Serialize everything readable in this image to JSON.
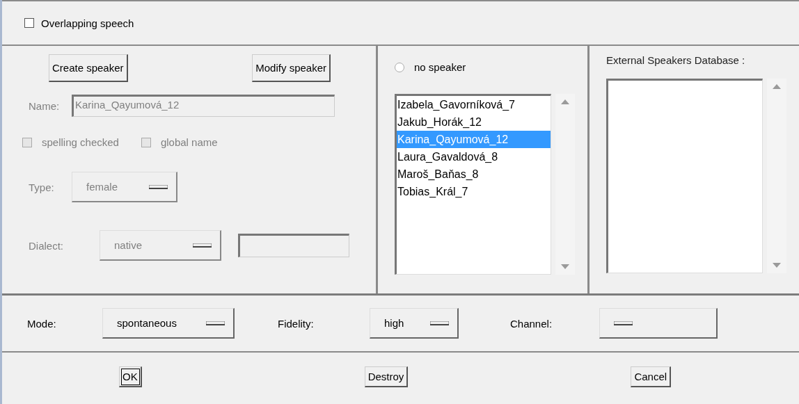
{
  "overlapping_speech": {
    "label": "Overlapping speech",
    "checked": false
  },
  "speaker_form": {
    "create_button": "Create speaker",
    "modify_button": "Modify speaker",
    "name": {
      "label": "Name:",
      "value": "Karina_Qayumová_12",
      "disabled": true
    },
    "checkboxes": [
      {
        "label": "spelling checked",
        "checked": false,
        "disabled": true
      },
      {
        "label": "global name",
        "checked": false,
        "disabled": true
      }
    ],
    "type": {
      "label": "Type:",
      "value": "female",
      "disabled": true
    },
    "dialect": {
      "label": "Dialect:",
      "value": "native",
      "disabled": true,
      "extra_value_disabled": true
    }
  },
  "speakers": {
    "no_speaker": {
      "label": "no speaker",
      "selected": false
    },
    "items": [
      {
        "label": "Izabela_Gavorníková_7",
        "selected": false
      },
      {
        "label": "Jakub_Horák_12",
        "selected": false
      },
      {
        "label": "Karina_Qayumová_12",
        "selected": true
      },
      {
        "label": "Laura_Gavaldová_8",
        "selected": false
      },
      {
        "label": "Maroš_Baňas_8",
        "selected": false
      },
      {
        "label": "Tobias_Král_7",
        "selected": false
      }
    ]
  },
  "external": {
    "title": "External Speakers Database :"
  },
  "options": [
    {
      "label": "Mode:",
      "value": "spontaneous"
    },
    {
      "label": "Fidelity:",
      "value": "high"
    },
    {
      "label": "Channel:"
    }
  ],
  "buttons": [
    {
      "label": "OK",
      "kind": "default"
    },
    {
      "label": "Destroy",
      "kind": "normal"
    },
    {
      "label": "Cancel",
      "kind": "normal"
    }
  ]
}
